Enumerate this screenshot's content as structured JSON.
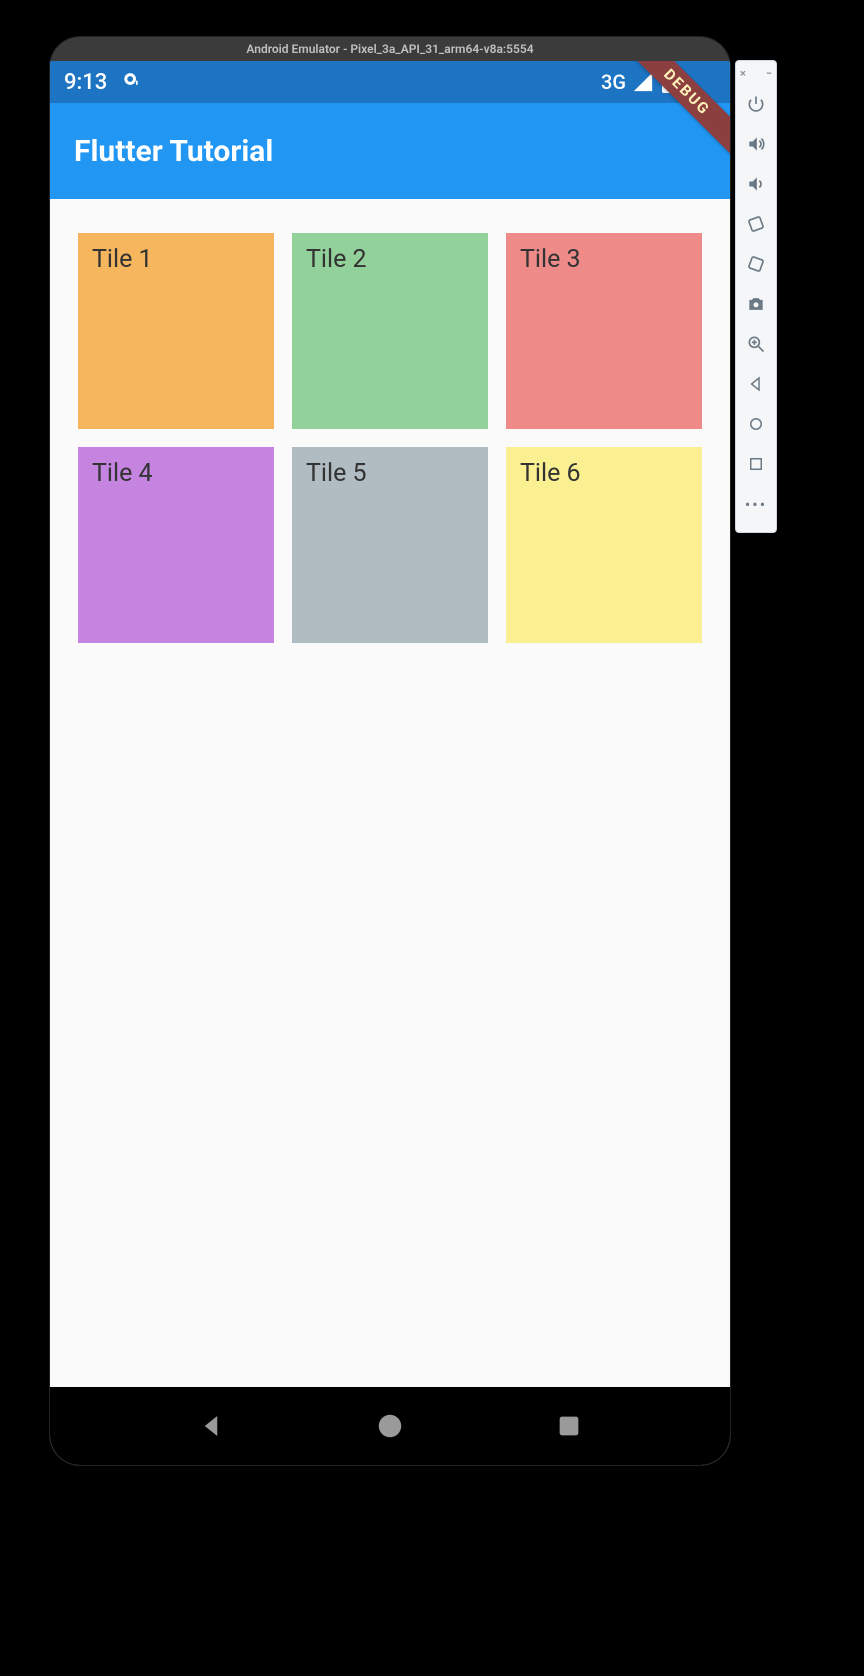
{
  "emulator": {
    "window_title": "Android Emulator - Pixel_3a_API_31_arm64-v8a:5554"
  },
  "status_bar": {
    "clock": "9:13",
    "network_label": "3G"
  },
  "debug_banner": {
    "label": "DEBUG"
  },
  "app_bar": {
    "title": "Flutter Tutorial"
  },
  "grid": {
    "tiles": [
      {
        "label": "Tile 1",
        "color": "#f5b65e"
      },
      {
        "label": "Tile 2",
        "color": "#93d19b"
      },
      {
        "label": "Tile 3",
        "color": "#ee8b89"
      },
      {
        "label": "Tile 4",
        "color": "#c584e0"
      },
      {
        "label": "Tile 5",
        "color": "#b0bbc2"
      },
      {
        "label": "Tile 6",
        "color": "#faf091"
      }
    ]
  },
  "side_toolbar": {
    "close_glyph": "×",
    "minimize_glyph": "−",
    "icons": {
      "power": "power-icon",
      "volume_up": "volume-up-icon",
      "volume_down": "volume-down-icon",
      "rotate_left": "rotate-left-icon",
      "rotate_right": "rotate-right-icon",
      "camera": "camera-icon",
      "zoom": "zoom-icon",
      "nav_back": "nav-back-icon",
      "nav_home": "nav-home-icon",
      "nav_overview": "nav-overview-icon",
      "more": "more-icon"
    }
  },
  "nav_bar": {
    "icons": {
      "back": "back-icon",
      "home": "home-icon",
      "overview": "overview-icon"
    }
  }
}
